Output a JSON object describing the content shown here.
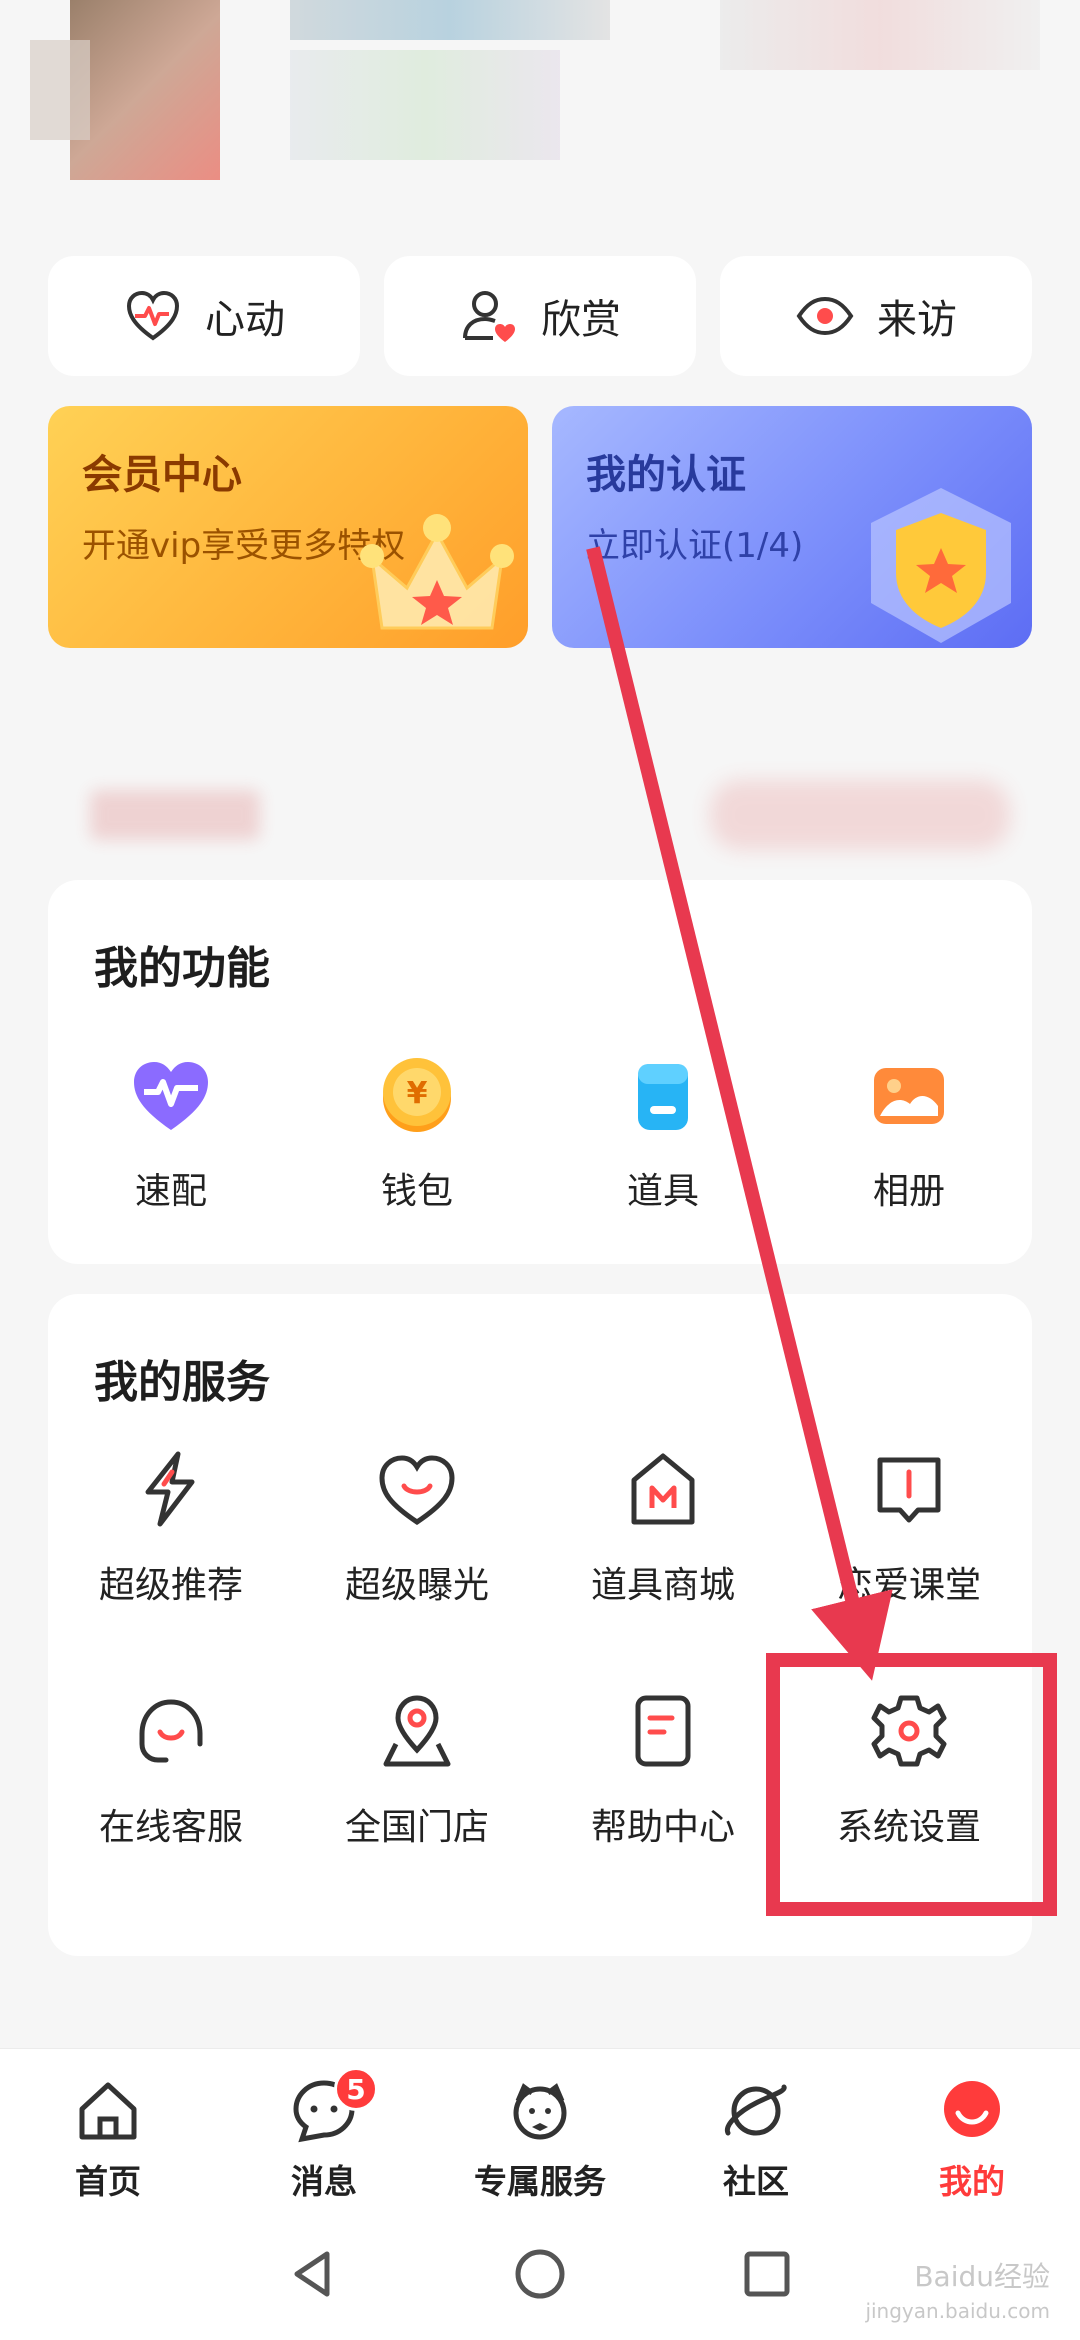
{
  "quick_stats": [
    {
      "label": "心动",
      "icon": "heart-pulse-icon"
    },
    {
      "label": "欣赏",
      "icon": "user-heart-icon"
    },
    {
      "label": "来访",
      "icon": "eye-icon"
    }
  ],
  "cards": {
    "vip": {
      "title": "会员中心",
      "subtitle": "开通vip享受更多特权"
    },
    "auth": {
      "title": "我的认证",
      "subtitle": "立即认证(1/4)"
    }
  },
  "functions": {
    "title": "我的功能",
    "items": [
      {
        "label": "速配",
        "icon": "quick-match-icon"
      },
      {
        "label": "钱包",
        "icon": "wallet-coin-icon"
      },
      {
        "label": "道具",
        "icon": "props-tag-icon"
      },
      {
        "label": "相册",
        "icon": "album-icon"
      }
    ]
  },
  "services": {
    "title": "我的服务",
    "items": [
      {
        "label": "超级推荐",
        "icon": "lightning-icon"
      },
      {
        "label": "超级曝光",
        "icon": "heart-smile-icon"
      },
      {
        "label": "道具商城",
        "icon": "mall-icon"
      },
      {
        "label": "恋爱课堂",
        "icon": "classroom-icon"
      },
      {
        "label": "在线客服",
        "icon": "headset-icon"
      },
      {
        "label": "全国门店",
        "icon": "location-pin-icon"
      },
      {
        "label": "帮助中心",
        "icon": "help-doc-icon"
      },
      {
        "label": "系统设置",
        "icon": "settings-gear-icon"
      }
    ]
  },
  "bottom_nav": {
    "items": [
      {
        "label": "首页",
        "icon": "home-icon"
      },
      {
        "label": "消息",
        "icon": "message-icon",
        "badge": "5"
      },
      {
        "label": "专属服务",
        "icon": "service-icon"
      },
      {
        "label": "社区",
        "icon": "planet-icon"
      },
      {
        "label": "我的",
        "icon": "me-icon",
        "active": true
      }
    ]
  },
  "watermark": {
    "line1": "Baidu经验",
    "line2": "jingyan.baidu.com"
  },
  "colors": {
    "accent": "#ff3b3b",
    "annotation": "#e8394f",
    "vip_gradient_start": "#ffd155",
    "auth_gradient_start": "#a6b8ff"
  }
}
